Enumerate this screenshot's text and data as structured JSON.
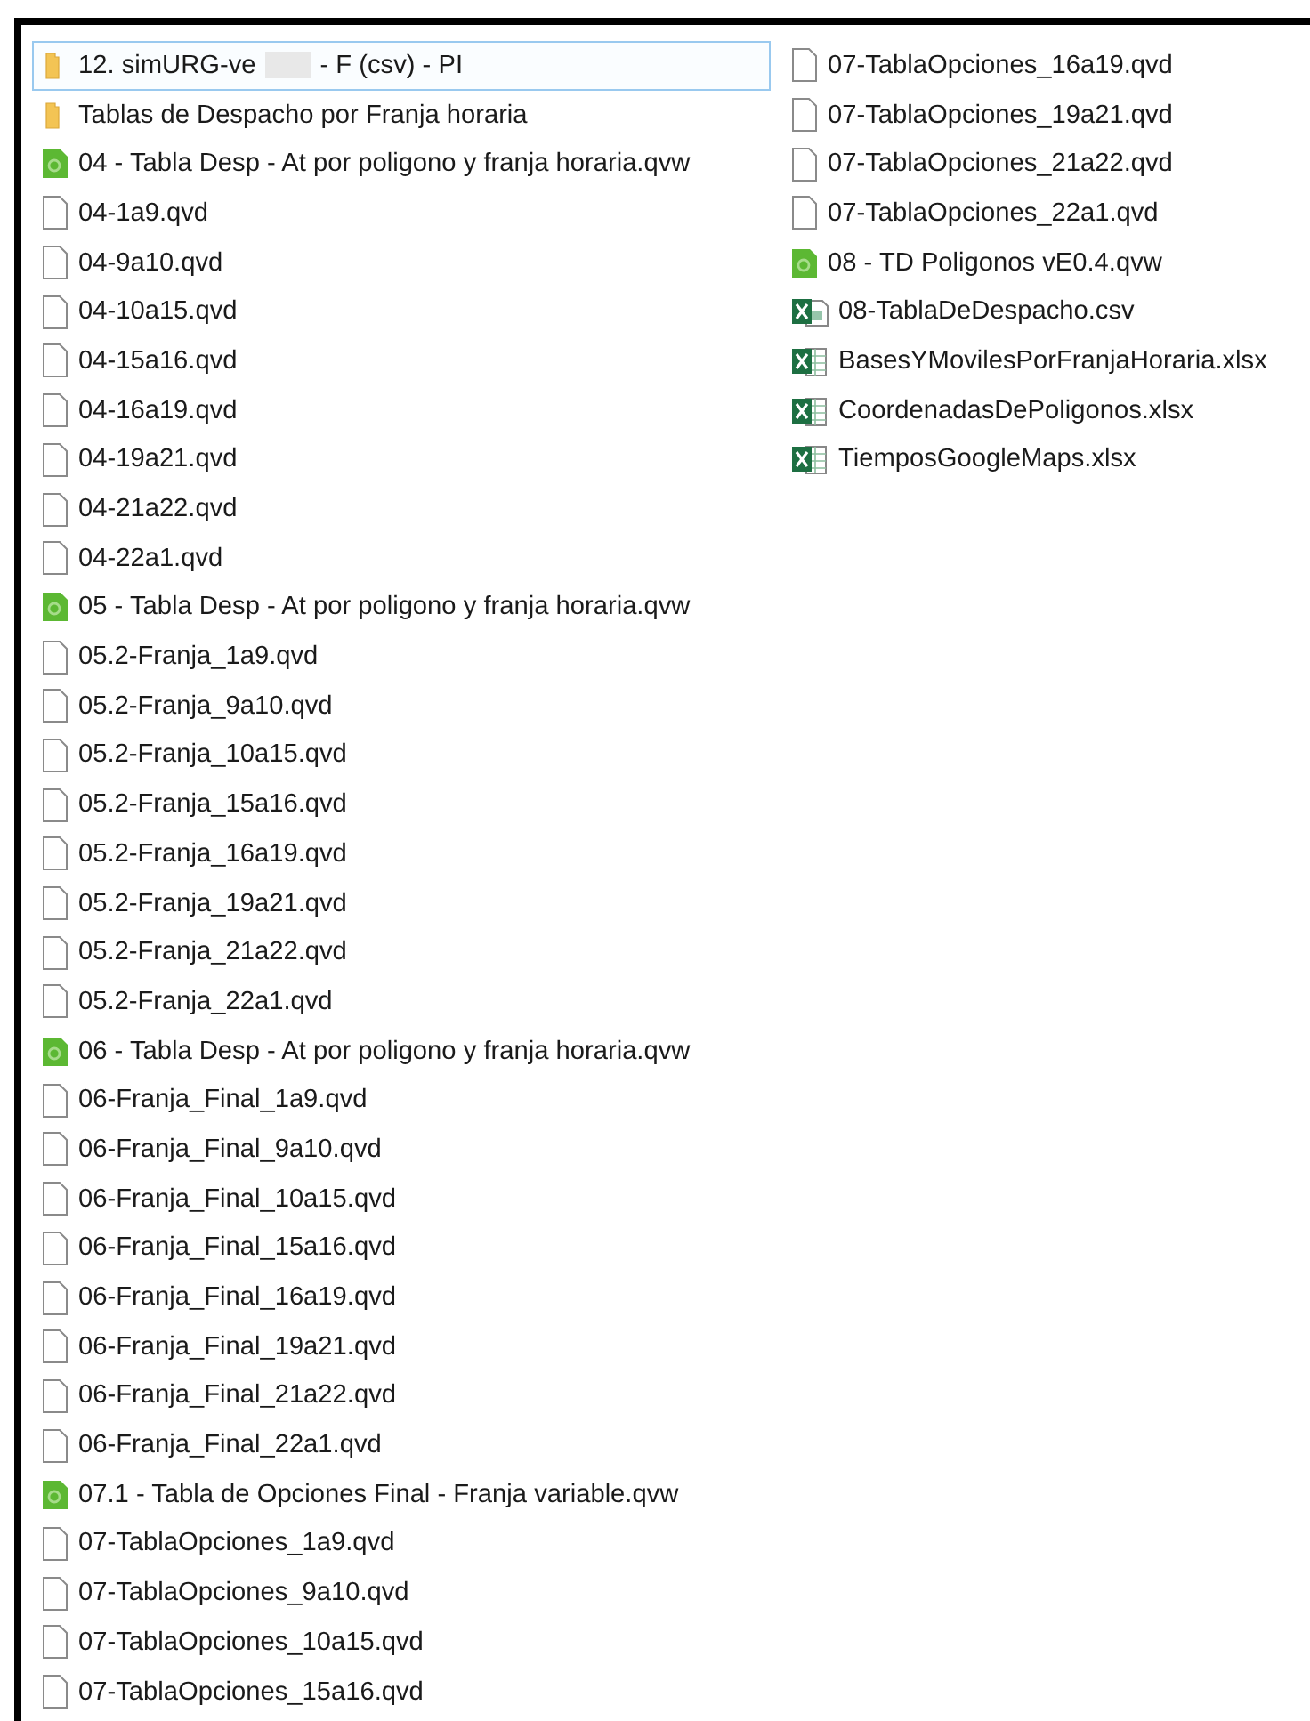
{
  "columns": [
    {
      "items": [
        {
          "kind": "folder",
          "name": "12. simURG-ve",
          "redacted": true,
          "suffix": " - F (csv) - PI",
          "selected": true
        },
        {
          "kind": "folder",
          "name": "Tablas de Despacho por Franja horaria",
          "selected": false
        },
        {
          "kind": "qvw",
          "name": "04 - Tabla Desp - At por poligono y franja horaria.qvw",
          "selected": false
        },
        {
          "kind": "file",
          "name": "04-1a9.qvd",
          "selected": false
        },
        {
          "kind": "file",
          "name": "04-9a10.qvd",
          "selected": false
        },
        {
          "kind": "file",
          "name": "04-10a15.qvd",
          "selected": false
        },
        {
          "kind": "file",
          "name": "04-15a16.qvd",
          "selected": false
        },
        {
          "kind": "file",
          "name": "04-16a19.qvd",
          "selected": false
        },
        {
          "kind": "file",
          "name": "04-19a21.qvd",
          "selected": false
        },
        {
          "kind": "file",
          "name": "04-21a22.qvd",
          "selected": false
        },
        {
          "kind": "file",
          "name": "04-22a1.qvd",
          "selected": false
        },
        {
          "kind": "qvw",
          "name": "05 - Tabla Desp - At por poligono y franja horaria.qvw",
          "selected": false
        },
        {
          "kind": "file",
          "name": "05.2-Franja_1a9.qvd",
          "selected": false
        },
        {
          "kind": "file",
          "name": "05.2-Franja_9a10.qvd",
          "selected": false
        },
        {
          "kind": "file",
          "name": "05.2-Franja_10a15.qvd",
          "selected": false
        },
        {
          "kind": "file",
          "name": "05.2-Franja_15a16.qvd",
          "selected": false
        },
        {
          "kind": "file",
          "name": "05.2-Franja_16a19.qvd",
          "selected": false
        },
        {
          "kind": "file",
          "name": "05.2-Franja_19a21.qvd",
          "selected": false
        },
        {
          "kind": "file",
          "name": "05.2-Franja_21a22.qvd",
          "selected": false
        },
        {
          "kind": "file",
          "name": "05.2-Franja_22a1.qvd",
          "selected": false
        },
        {
          "kind": "qvw",
          "name": "06 - Tabla Desp - At por poligono y franja horaria.qvw",
          "selected": false
        },
        {
          "kind": "file",
          "name": "06-Franja_Final_1a9.qvd",
          "selected": false
        },
        {
          "kind": "file",
          "name": "06-Franja_Final_9a10.qvd",
          "selected": false
        },
        {
          "kind": "file",
          "name": "06-Franja_Final_10a15.qvd",
          "selected": false
        },
        {
          "kind": "file",
          "name": "06-Franja_Final_15a16.qvd",
          "selected": false
        },
        {
          "kind": "file",
          "name": "06-Franja_Final_16a19.qvd",
          "selected": false
        },
        {
          "kind": "file",
          "name": "06-Franja_Final_19a21.qvd",
          "selected": false
        },
        {
          "kind": "file",
          "name": "06-Franja_Final_21a22.qvd",
          "selected": false
        },
        {
          "kind": "file",
          "name": "06-Franja_Final_22a1.qvd",
          "selected": false
        },
        {
          "kind": "qvw",
          "name": "07.1 - Tabla de Opciones Final - Franja variable.qvw",
          "selected": false
        },
        {
          "kind": "file",
          "name": "07-TablaOpciones_1a9.qvd",
          "selected": false
        },
        {
          "kind": "file",
          "name": "07-TablaOpciones_9a10.qvd",
          "selected": false
        },
        {
          "kind": "file",
          "name": "07-TablaOpciones_10a15.qvd",
          "selected": false
        },
        {
          "kind": "file",
          "name": "07-TablaOpciones_15a16.qvd",
          "selected": false
        }
      ]
    },
    {
      "items": [
        {
          "kind": "file",
          "name": "07-TablaOpciones_16a19.qvd",
          "selected": false
        },
        {
          "kind": "file",
          "name": "07-TablaOpciones_19a21.qvd",
          "selected": false
        },
        {
          "kind": "file",
          "name": "07-TablaOpciones_21a22.qvd",
          "selected": false
        },
        {
          "kind": "file",
          "name": "07-TablaOpciones_22a1.qvd",
          "selected": false
        },
        {
          "kind": "qvw",
          "name": "08 - TD Poligonos vE0.4.qvw",
          "selected": false
        },
        {
          "kind": "csv",
          "name": "08-TablaDeDespacho.csv",
          "selected": false
        },
        {
          "kind": "xlsx",
          "name": "BasesYMovilesPorFranjaHoraria.xlsx",
          "selected": false
        },
        {
          "kind": "xlsx",
          "name": "CoordenadasDePoligonos.xlsx",
          "selected": false
        },
        {
          "kind": "xlsx",
          "name": "TiemposGoogleMaps.xlsx",
          "selected": false
        }
      ]
    }
  ]
}
